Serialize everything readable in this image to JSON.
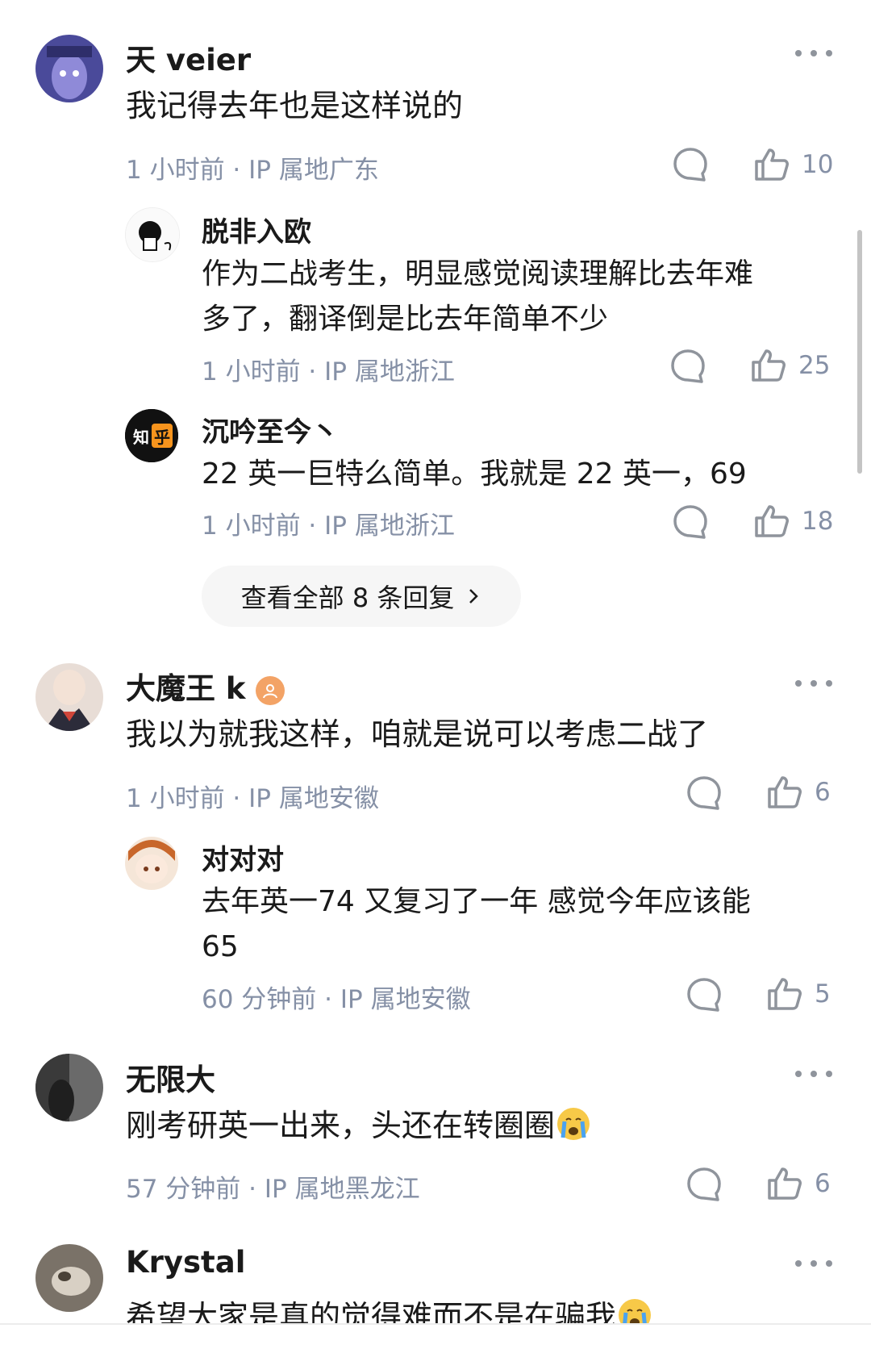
{
  "comments": [
    {
      "author": "天 veier",
      "text": "我记得去年也是这样说的",
      "time": "1 小时前",
      "ip": "IP 属地广东",
      "likes": "10",
      "replies": [
        {
          "author": "脱非入欧",
          "text_lines": [
            "作为二战考生，明显感觉阅读理解比去年难",
            "多了，翻译倒是比去年简单不少"
          ],
          "time": "1 小时前",
          "ip": "IP 属地浙江",
          "likes": "25"
        },
        {
          "author": "沉吟至今丶",
          "text_lines": [
            "22 英一巨特么简单。我就是 22 英一，69"
          ],
          "time": "1 小时前",
          "ip": "IP 属地浙江",
          "likes": "18"
        }
      ],
      "view_all_label": "查看全部 8 条回复"
    },
    {
      "author": "大魔王 k",
      "text": "我以为就我这样，咱就是说可以考虑二战了",
      "time": "1 小时前",
      "ip": "IP 属地安徽",
      "likes": "6",
      "replies": [
        {
          "author": "对对对",
          "text_lines": [
            "去年英一74  又复习了一年  感觉今年应该能",
            "65"
          ],
          "time": "60 分钟前",
          "ip": "IP 属地安徽",
          "likes": "5"
        }
      ]
    },
    {
      "author": "无限大",
      "text": "刚考研英一出来，头还在转圈圈",
      "time": "57 分钟前",
      "ip": "IP 属地黑龙江",
      "likes": "6"
    },
    {
      "author": "Krystal",
      "text": "希望大家是真的觉得难而不是在骗我"
    }
  ],
  "zhihu_badge": "知乎",
  "icons": {
    "more": "more-dots-icon",
    "reply": "comment-bubble-icon",
    "like": "thumbs-up-icon",
    "chevron": "chevron-right-icon",
    "crying_emoji": "crying-face-emoji"
  },
  "colors": {
    "text_primary": "#1a1a1a",
    "text_meta": "#8590a6",
    "icon": "#8f949c",
    "button_bg": "#f6f6f6"
  }
}
